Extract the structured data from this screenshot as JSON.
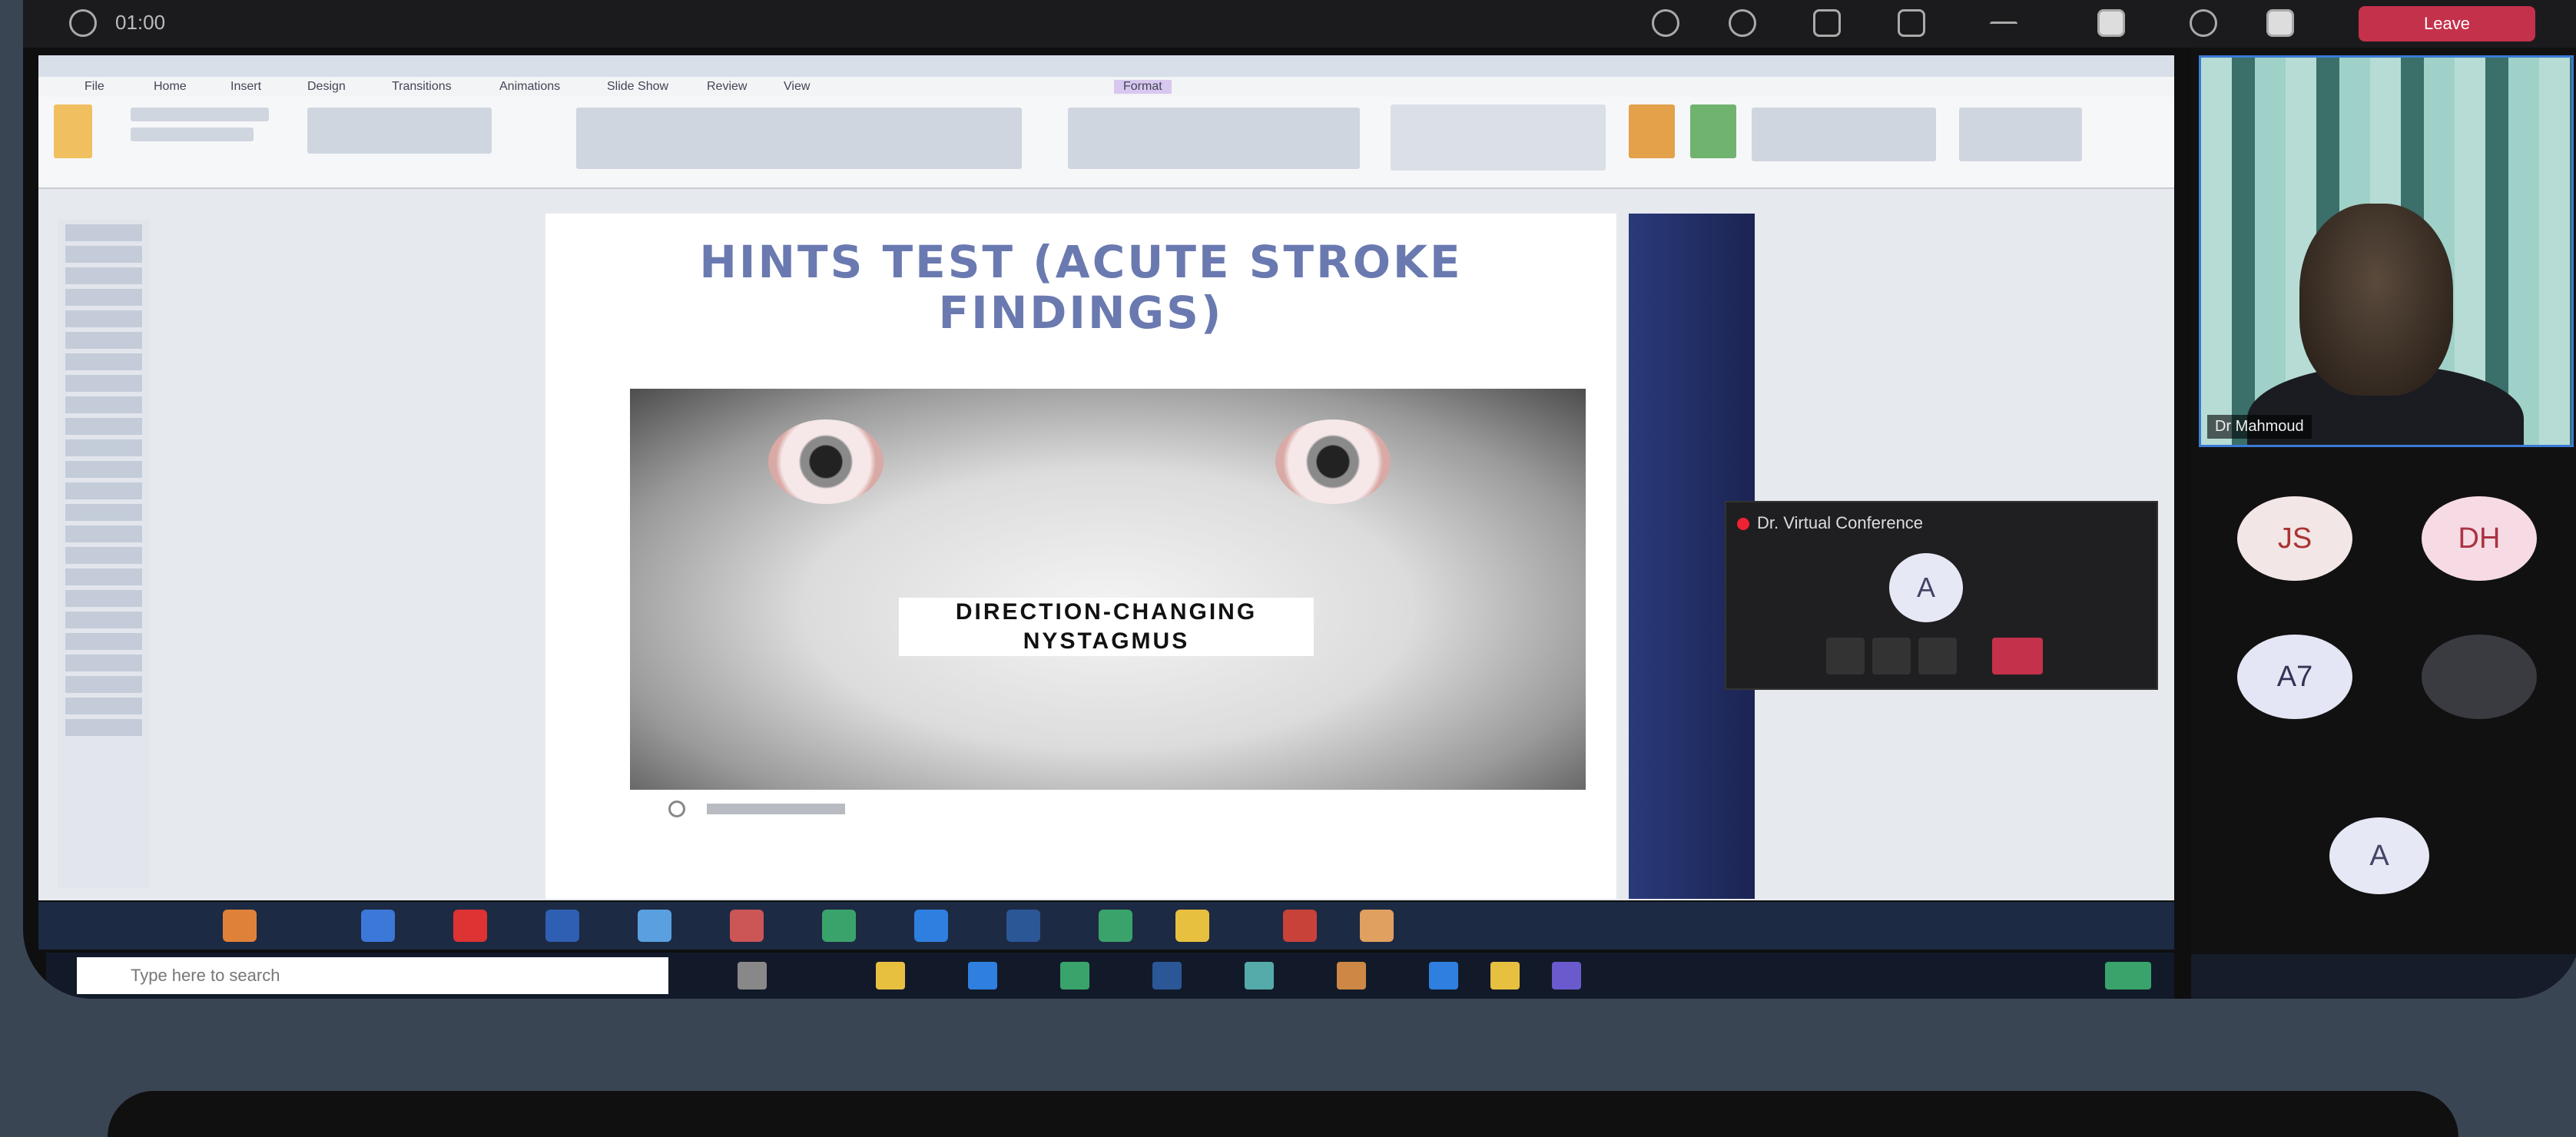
{
  "topbar": {
    "meeting_time": "01:00",
    "leave_label": "Leave",
    "icons": [
      "participants-icon",
      "chat-icon",
      "reactions-icon",
      "rooms-icon",
      "more-icon",
      "camera-icon",
      "mic-icon",
      "share-icon"
    ]
  },
  "ppt": {
    "tabs": [
      "File",
      "Home",
      "Insert",
      "Design",
      "Transitions",
      "Animations",
      "Slide Show",
      "Review",
      "View",
      "Format"
    ]
  },
  "slide": {
    "title_line1": "HINTS TEST (ACUTE STROKE",
    "title_line2": "FINDINGS)",
    "caption_line1": "DIRECTION-CHANGING",
    "caption_line2": "NYSTAGMUS"
  },
  "taskbar": {
    "search_placeholder": "Type here to search"
  },
  "mini_call": {
    "title": "Dr. Virtual Conference",
    "avatar": "A"
  },
  "participants": {
    "presenter_name": "Dr Mahmoud",
    "tiles": [
      {
        "initials": "JS",
        "color": "#f3e6e6",
        "text_color": "#a33"
      },
      {
        "initials": "DH",
        "color": "#f7dbe4",
        "text_color": "#a34"
      },
      {
        "initials": "A7",
        "color": "#e4e6f5",
        "text_color": "#335"
      },
      {
        "initials": "A",
        "color": "#e7e8f5",
        "text_color": "#446"
      }
    ]
  }
}
